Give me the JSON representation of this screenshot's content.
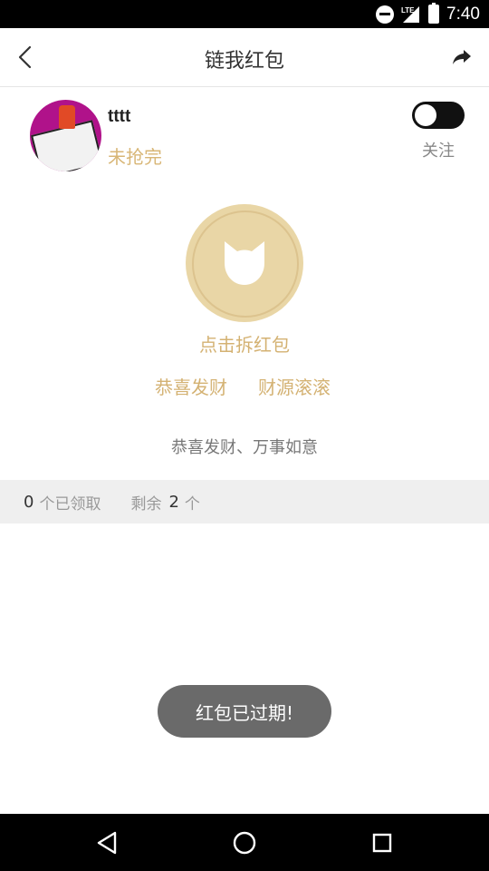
{
  "status_bar": {
    "time": "7:40",
    "network": "LTE",
    "icons": [
      "do-not-disturb-icon",
      "signal-icon",
      "battery-icon"
    ]
  },
  "header": {
    "title": "链我红包",
    "back_icon": "chevron-left-icon",
    "share_icon": "share-icon"
  },
  "profile": {
    "name": "tttt",
    "status": "未抢完",
    "follow_label": "关注",
    "follow_on": false
  },
  "envelope": {
    "icon": "cat-head-icon",
    "tap_text": "点击拆红包",
    "blessings": [
      "恭喜发财",
      "财源滚滚"
    ],
    "message": "恭喜发财、万事如意"
  },
  "stats": {
    "claimed_count": "0",
    "claimed_label": "个已领取",
    "remaining_label": "剩余",
    "remaining_count": "2",
    "remaining_unit": "个"
  },
  "toast": {
    "text": "红包已过期!"
  },
  "nav": {
    "buttons": [
      "back-triangle-icon",
      "home-circle-icon",
      "recents-square-icon"
    ]
  },
  "colors": {
    "accent_gold": "#d4b273",
    "envelope_fill": "#e9d6a6",
    "stats_bg": "#efefef",
    "toast_bg": "#6a6a6a"
  }
}
